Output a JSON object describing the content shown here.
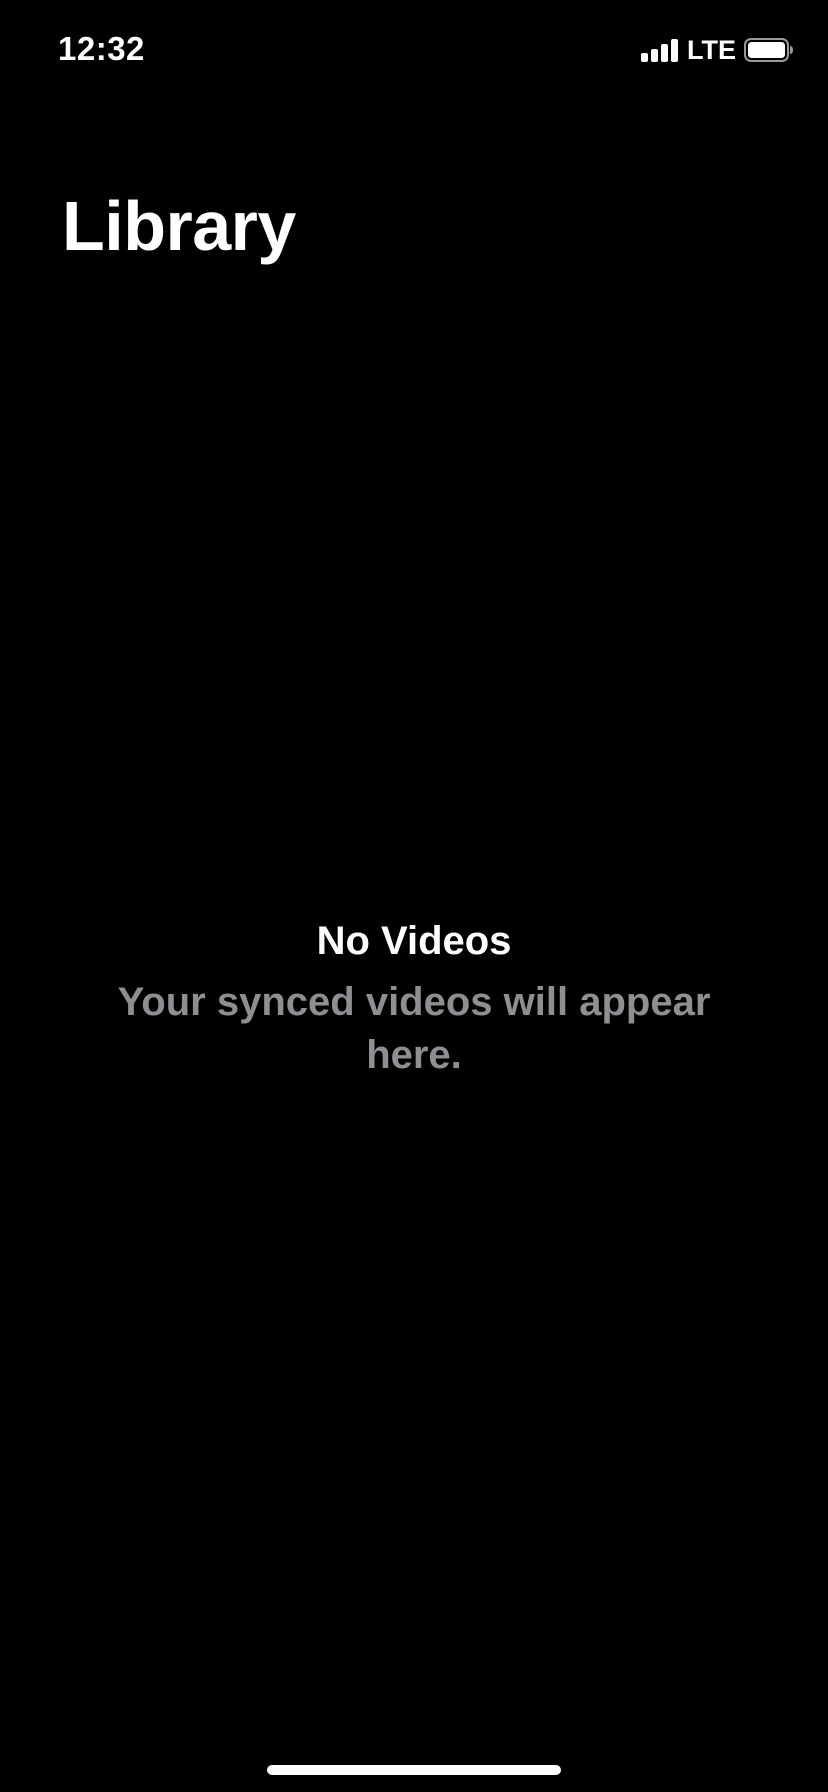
{
  "status_bar": {
    "time": "12:32",
    "network": "LTE",
    "icons": [
      "signal-icon",
      "battery-icon"
    ]
  },
  "header": {
    "title": "Library"
  },
  "empty_state": {
    "title": "No Videos",
    "message": "Your synced videos will appear here."
  },
  "colors": {
    "background": "#000000",
    "primary_text": "#ffffff",
    "secondary_text": "#8e8e93"
  }
}
